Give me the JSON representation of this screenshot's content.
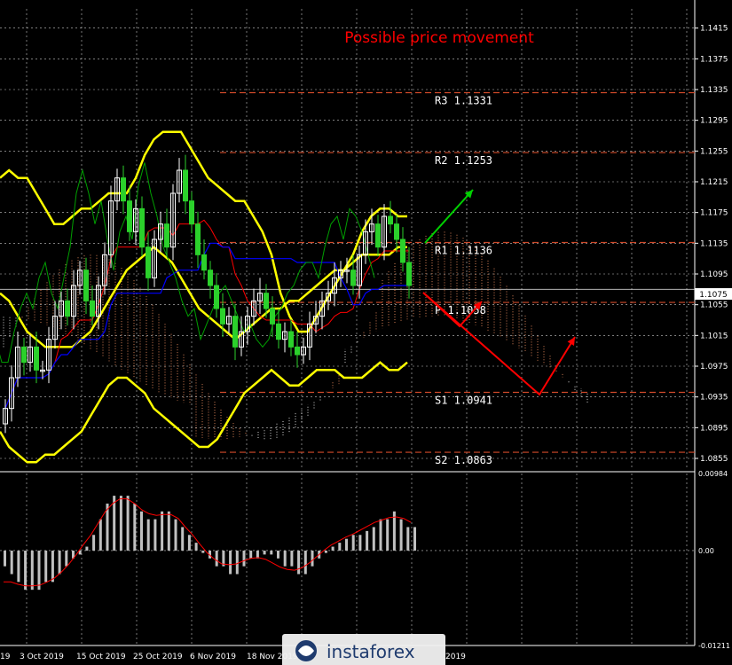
{
  "annotation": "Possible price movement",
  "current_price": "1.1075",
  "watermark": "instaforex",
  "colors": {
    "background": "#000000",
    "grid": "#c8c8c8",
    "bull_candle": "#ffffff",
    "bear_candle": "#2bd12b",
    "bollinger": "#ffff00",
    "ichimoku_tenkan": "#ff0000",
    "ichimoku_kijun": "#0000ff",
    "chikou": "#00a000",
    "cloud": "#ff9966",
    "cloud_alt": "#ffffff",
    "pivot_lines": "#d04a2a",
    "arrow_up": "#00d000",
    "arrow_down": "#ff0000",
    "annotation": "#ff0000",
    "macd_hist": "#c0c0c0",
    "macd_signal": "#ff0000"
  },
  "icons": [
    "instaforex-logo-icon"
  ],
  "chart_data": [
    {
      "type": "candlestick",
      "title": "",
      "ylim": [
        1.084,
        1.144
      ],
      "y_ticks": [
        "1.1415",
        "1.1375",
        "1.1335",
        "1.1295",
        "1.1255",
        "1.1215",
        "1.1175",
        "1.1135",
        "1.1095",
        "1.1055",
        "1.1015",
        "1.0975",
        "1.0935",
        "1.0895",
        "1.0855"
      ],
      "x_ticks": [
        "19",
        "3 Oct 2019",
        "15 Oct 2019",
        "25 Oct 2019",
        "6 Nov 2019",
        "18 Nov 2019",
        "",
        "",
        "2019"
      ],
      "pivot_levels": [
        {
          "label": "R3",
          "value": "1.1331"
        },
        {
          "label": "R2",
          "value": "1.1253"
        },
        {
          "label": "R1",
          "value": "1.1136"
        },
        {
          "label": "P",
          "value": "1.1058"
        },
        {
          "label": "S1",
          "value": "1.0941"
        },
        {
          "label": "S2",
          "value": "1.0863"
        }
      ],
      "closes": [
        1.092,
        1.096,
        1.1,
        1.098,
        1.1,
        1.097,
        1.097,
        1.101,
        1.104,
        1.106,
        1.104,
        1.108,
        1.11,
        1.106,
        1.104,
        1.108,
        1.112,
        1.119,
        1.122,
        1.119,
        1.115,
        1.118,
        1.113,
        1.109,
        1.114,
        1.116,
        1.113,
        1.12,
        1.123,
        1.119,
        1.116,
        1.112,
        1.11,
        1.108,
        1.105,
        1.103,
        1.104,
        1.1,
        1.102,
        1.104,
        1.106,
        1.107,
        1.105,
        1.103,
        1.101,
        1.102,
        1.1,
        1.099,
        1.1,
        1.103,
        1.104,
        1.106,
        1.107,
        1.109,
        1.11,
        1.11,
        1.108,
        1.112,
        1.115,
        1.116,
        1.113,
        1.117,
        1.116,
        1.114,
        1.111,
        1.108
      ],
      "bollinger_upper": [
        1.122,
        1.123,
        1.122,
        1.122,
        1.12,
        1.118,
        1.116,
        1.116,
        1.117,
        1.118,
        1.118,
        1.119,
        1.12,
        1.12,
        1.12,
        1.122,
        1.125,
        1.127,
        1.128,
        1.128,
        1.128,
        1.126,
        1.124,
        1.122,
        1.121,
        1.12,
        1.119,
        1.119,
        1.117,
        1.115,
        1.112,
        1.107,
        1.104,
        1.102,
        1.102,
        1.104,
        1.106,
        1.108,
        1.11,
        1.112,
        1.115,
        1.117,
        1.118,
        1.118,
        1.117,
        1.117
      ],
      "bollinger_middle": [
        1.107,
        1.106,
        1.104,
        1.102,
        1.101,
        1.1,
        1.1,
        1.1,
        1.1,
        1.101,
        1.102,
        1.104,
        1.106,
        1.108,
        1.11,
        1.111,
        1.112,
        1.113,
        1.112,
        1.111,
        1.109,
        1.107,
        1.105,
        1.104,
        1.103,
        1.102,
        1.101,
        1.102,
        1.103,
        1.104,
        1.105,
        1.105,
        1.106,
        1.106,
        1.107,
        1.108,
        1.109,
        1.11,
        1.11,
        1.111,
        1.112,
        1.112,
        1.112,
        1.112,
        1.113,
        1.113
      ],
      "bollinger_lower": [
        1.089,
        1.087,
        1.086,
        1.085,
        1.085,
        1.086,
        1.086,
        1.087,
        1.088,
        1.089,
        1.091,
        1.093,
        1.095,
        1.096,
        1.096,
        1.095,
        1.094,
        1.092,
        1.091,
        1.09,
        1.089,
        1.088,
        1.087,
        1.087,
        1.088,
        1.09,
        1.092,
        1.094,
        1.095,
        1.096,
        1.097,
        1.096,
        1.095,
        1.095,
        1.096,
        1.097,
        1.097,
        1.097,
        1.096,
        1.096,
        1.096,
        1.097,
        1.098,
        1.097,
        1.097,
        1.098
      ]
    },
    {
      "type": "bar",
      "title": "",
      "ylim": [
        -0.01211,
        0.00984
      ],
      "y_ticks": [
        "0.00984",
        "0.00",
        "-0.01211"
      ],
      "histogram": [
        -0.002,
        -0.003,
        -0.004,
        -0.005,
        -0.005,
        -0.005,
        -0.004,
        -0.004,
        -0.003,
        -0.002,
        -0.001,
        -0.0005,
        0.0005,
        0.002,
        0.004,
        0.006,
        0.007,
        0.007,
        0.007,
        0.006,
        0.005,
        0.004,
        0.004,
        0.005,
        0.005,
        0.004,
        0.003,
        0.002,
        0.001,
        -0.0003,
        -0.001,
        -0.002,
        -0.002,
        -0.003,
        -0.003,
        -0.002,
        -0.001,
        -0.001,
        -0.0005,
        -0.0005,
        -0.001,
        -0.002,
        -0.002,
        -0.003,
        -0.003,
        -0.002,
        -0.001,
        -0.0003,
        0.0005,
        0.001,
        0.0015,
        0.002,
        0.002,
        0.0025,
        0.003,
        0.004,
        0.004,
        0.005,
        0.004,
        0.003,
        0.003
      ],
      "signal": [
        -0.004,
        -0.004,
        -0.0043,
        -0.0045,
        -0.0045,
        -0.0044,
        -0.004,
        -0.0035,
        -0.0027,
        -0.0017,
        -0.0005,
        0.0008,
        0.002,
        0.0035,
        0.005,
        0.006,
        0.0066,
        0.0066,
        0.006,
        0.0052,
        0.0047,
        0.0045,
        0.0046,
        0.0046,
        0.0041,
        0.003,
        0.002,
        0.0008,
        -0.0003,
        -0.0011,
        -0.0017,
        -0.0018,
        -0.0017,
        -0.0013,
        -0.001,
        -0.0009,
        -0.0011,
        -0.0016,
        -0.0021,
        -0.0024,
        -0.0025,
        -0.0022,
        -0.0016,
        -0.0008,
        0.0,
        0.0007,
        0.0012,
        0.0017,
        0.0021,
        0.0026,
        0.0031,
        0.0036,
        0.0039,
        0.0042,
        0.0043,
        0.0041,
        0.0036
      ]
    }
  ]
}
